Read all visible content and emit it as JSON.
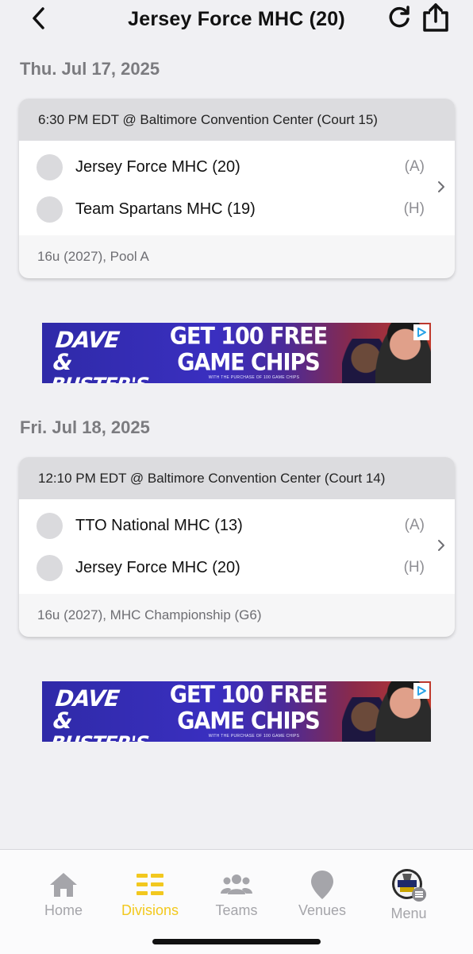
{
  "header": {
    "title": "Jersey Force MHC (20)",
    "back_icon": "chevron-left-icon",
    "refresh_icon": "refresh-icon",
    "share_icon": "share-icon"
  },
  "days": [
    {
      "date": "Thu. Jul 17, 2025",
      "game": {
        "time_location": "6:30 PM EDT @ Baltimore Convention Center (Court 15)",
        "teams": [
          {
            "name": "Jersey Force MHC (20)",
            "side": "(A)"
          },
          {
            "name": "Team Spartans MHC (19)",
            "side": "(H)"
          }
        ],
        "division": "16u (2027), Pool A"
      }
    },
    {
      "date": "Fri. Jul 18, 2025",
      "game": {
        "time_location": "12:10 PM EDT @ Baltimore Convention Center (Court 14)",
        "teams": [
          {
            "name": "TTO National MHC (13)",
            "side": "(A)"
          },
          {
            "name": "Jersey Force MHC (20)",
            "side": "(H)"
          }
        ],
        "division": "16u (2027), MHC Championship (G6)"
      }
    }
  ],
  "ad": {
    "brand_line1": "DAVE &",
    "brand_line2": "BUSTER'S",
    "headline_line1": "GET 100 FREE",
    "headline_line2": "GAME CHIPS",
    "fine_print": "WITH THE PURCHASE OF 100 GAME CHIPS"
  },
  "tabs": [
    {
      "label": "Home",
      "icon": "home-icon",
      "active": false
    },
    {
      "label": "Divisions",
      "icon": "divisions-icon",
      "active": true
    },
    {
      "label": "Teams",
      "icon": "teams-icon",
      "active": false
    },
    {
      "label": "Venues",
      "icon": "location-pin-icon",
      "active": false
    },
    {
      "label": "Menu",
      "icon": "menu-avatar-icon",
      "active": false
    }
  ],
  "colors": {
    "accent": "#f2c81e",
    "inactive_tab": "#a5a5aa",
    "background": "#f0f0f3",
    "card_header": "#dcdcdf"
  }
}
